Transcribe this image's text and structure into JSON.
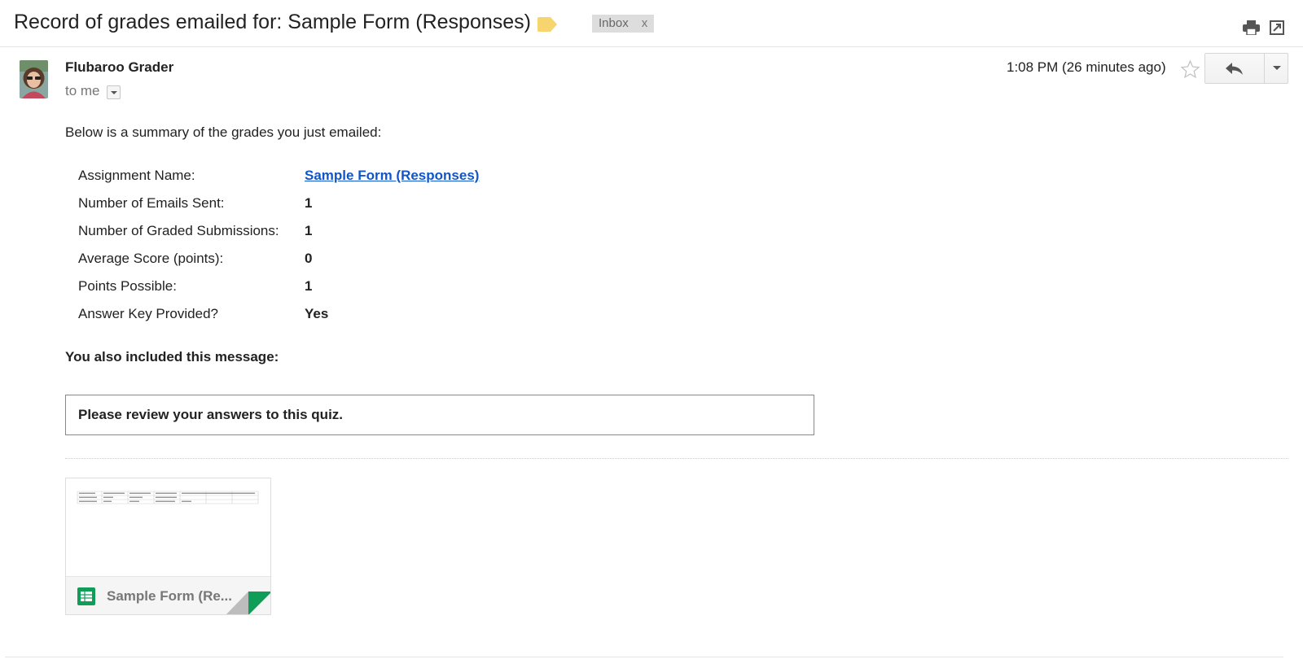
{
  "thread": {
    "subject": "Record of grades emailed for: Sample Form (Responses)",
    "label_color": "#f7d56e",
    "inbox_label": "Inbox",
    "inbox_remove": "x"
  },
  "message": {
    "sender": "Flubaroo Grader",
    "to_line": "to me",
    "timestamp": "1:08 PM (26 minutes ago)",
    "intro": "Below is a summary of the grades you just emailed:",
    "summary": [
      {
        "key": "Assignment Name:",
        "value": "Sample Form (Responses)"
      },
      {
        "key": "Number of Emails Sent:",
        "value": "1"
      },
      {
        "key": "Number of Graded Submissions:",
        "value": "1"
      },
      {
        "key": "Average Score (points):",
        "value": "0"
      },
      {
        "key": "Points Possible:",
        "value": "1"
      },
      {
        "key": "Answer Key Provided?",
        "value": "Yes"
      }
    ],
    "also_included": "You also included this message:",
    "custom_message": "Please review your answers to this quiz."
  },
  "attachment": {
    "name": "Sample Form (Re...",
    "icon": "google-sheets-icon",
    "accent_color": "#0f9d58"
  }
}
